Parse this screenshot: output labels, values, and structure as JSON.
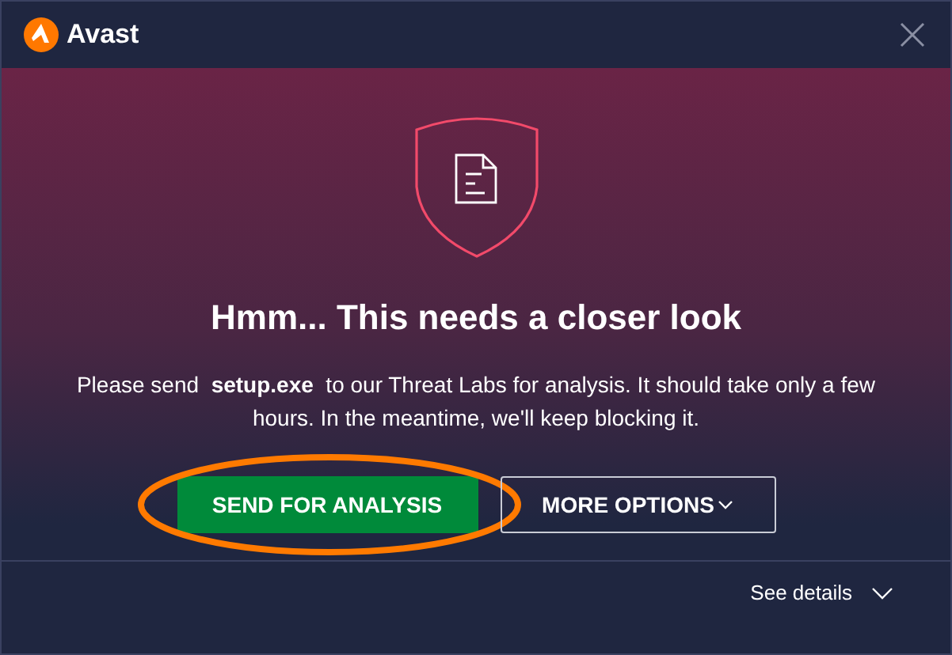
{
  "window": {
    "brand": "Avast"
  },
  "heading": "Hmm... This needs a closer look",
  "message": "Please send  **setup.exe**  to our Threat Labs for analysis. It should take only a few hours. In the meantime, we'll keep blocking it.",
  "buttons": [
    {
      "kind": "primary",
      "label": "SEND FOR ANALYSIS",
      "highlighted": true
    },
    {
      "kind": "dropdown",
      "label": "MORE OPTIONS",
      "highlighted": false
    }
  ],
  "footer": {
    "link": "See details",
    "expanded": false
  }
}
